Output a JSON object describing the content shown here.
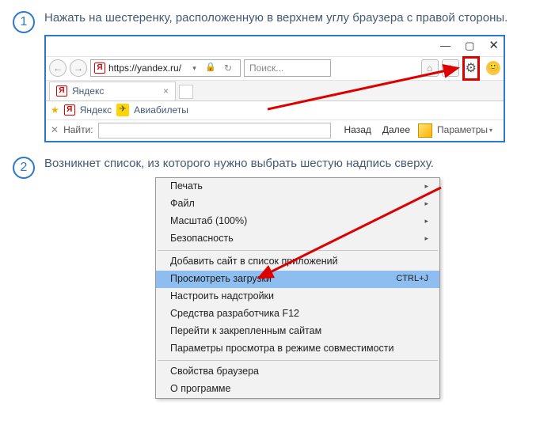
{
  "steps": {
    "s1": {
      "num": "1",
      "text": "Нажать на шестеренку, расположенную в верхнем углу браузера с правой стороны."
    },
    "s2": {
      "num": "2",
      "text": "Возникнет список, из которого нужно выбрать шестую надпись сверху."
    }
  },
  "browser": {
    "url": "https://yandex.ru/",
    "search_placeholder": "Поиск...",
    "tab_title": "Яндекс",
    "bookmarks": {
      "b1": "Яндекс",
      "b2": "Авиабилеты"
    },
    "find_label": "Найти:",
    "nav_back": "Назад",
    "nav_forward": "Далее",
    "params": "Параметры"
  },
  "menu": {
    "m1": "Печать",
    "m2": "Файл",
    "m3": "Масштаб (100%)",
    "m4": "Безопасность",
    "m5": "Добавить сайт в список приложений",
    "m6": "Просмотреть загрузки",
    "m6_shortcut": "CTRL+J",
    "m7": "Настроить надстройки",
    "m8": "Средства разработчика F12",
    "m9": "Перейти к закрепленным сайтам",
    "m10": "Параметры просмотра в режиме совместимости",
    "m11": "Свойства браузера",
    "m12": "О программе"
  }
}
